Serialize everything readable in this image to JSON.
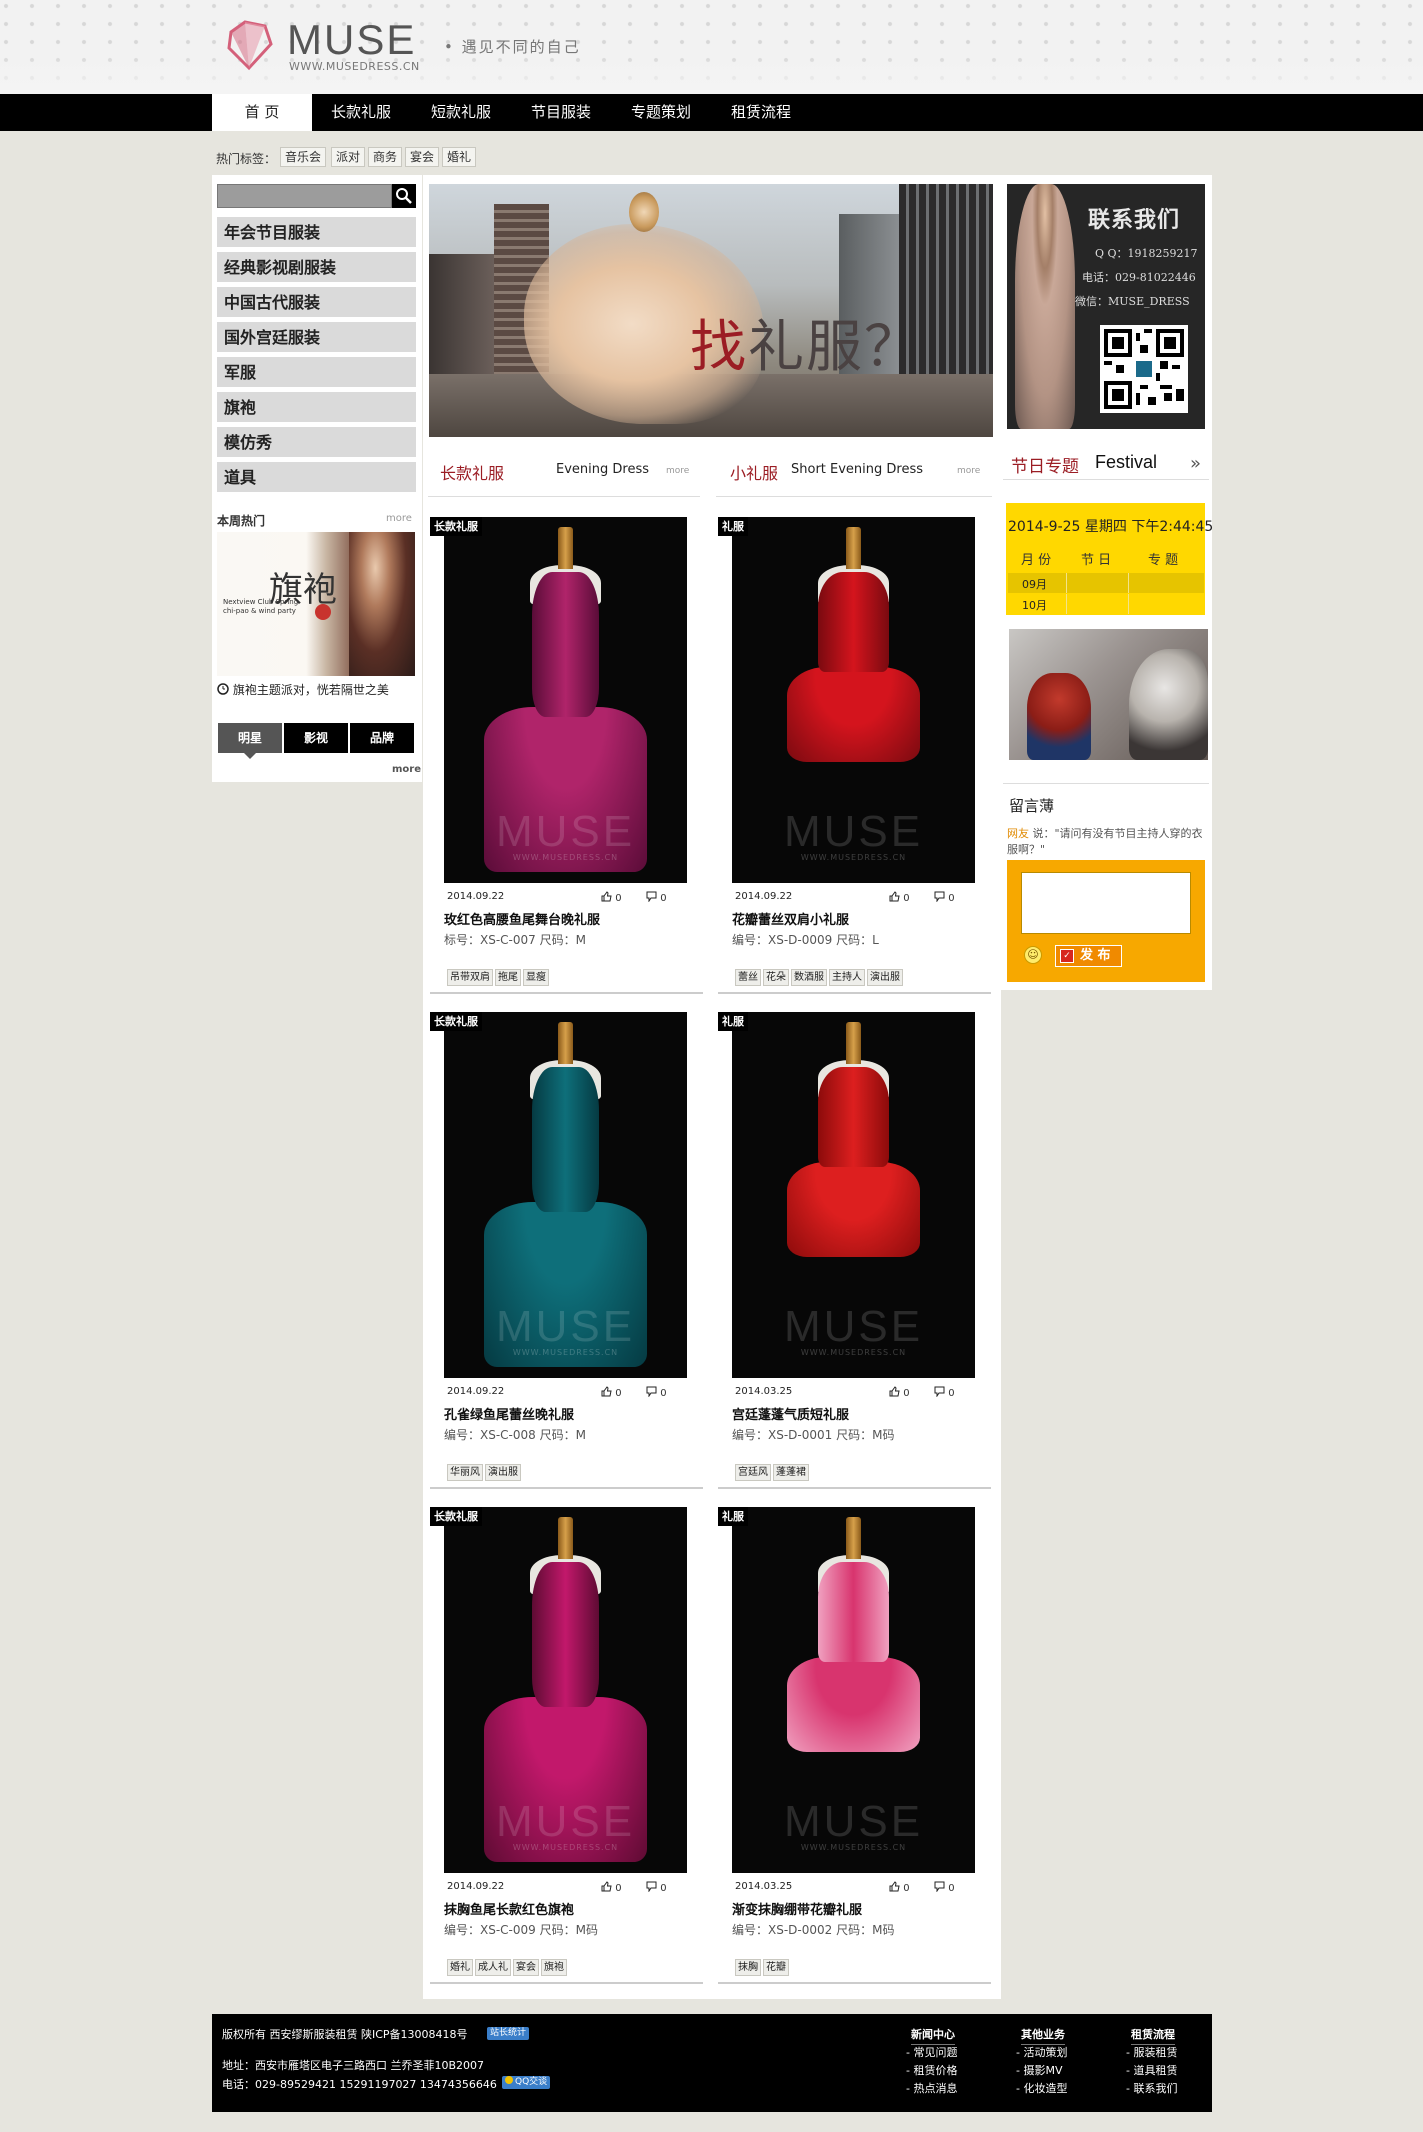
{
  "header": {
    "logo_text": "MUSE",
    "logo_url": "WWW.MUSEDRESS.CN",
    "slogan": "• 遇见不同的自己"
  },
  "nav": {
    "items": [
      {
        "label": "首 页",
        "active": true
      },
      {
        "label": "长款礼服"
      },
      {
        "label": "短款礼服"
      },
      {
        "label": "节目服装"
      },
      {
        "label": "专题策划"
      },
      {
        "label": "租赁流程"
      }
    ]
  },
  "hot_tags": {
    "label": "热门标签：",
    "tags": [
      "音乐会",
      "派对",
      "商务",
      "宴会",
      "婚礼"
    ]
  },
  "sidebar": {
    "search_placeholder": "",
    "categories": [
      "年会节目服装",
      "经典影视剧服装",
      "中国古代服装",
      "国外宫廷服装",
      "军服",
      "旗袍",
      "模仿秀",
      "道具"
    ],
    "week_hot": {
      "label": "本周热门",
      "more": "more",
      "image_big_text": "旗袍",
      "image_small_text": "Nextview Club Spring chi-pao & wind party",
      "caption": "旗袍主题派对，恍若隔世之美"
    },
    "tabs": [
      "明星",
      "影视",
      "品牌"
    ],
    "tabs_more": "more"
  },
  "banner": {
    "text_red": "找",
    "text_rest": "礼服？"
  },
  "sections": {
    "long": {
      "cn": "长款礼服",
      "en": "Evening Dress",
      "more": "more"
    },
    "short": {
      "cn": "小礼服",
      "en": "Short Evening Dress",
      "more": "more"
    }
  },
  "watermark": {
    "brand": "MUSE",
    "url": "WWW.MUSEDRESS.CN"
  },
  "products": [
    {
      "badge": "长款礼服",
      "date": "2014.09.22",
      "likes": "0",
      "comments": "0",
      "title": "玫红色高腰鱼尾舞台晚礼服",
      "code": "标号：XS-C-007 尺码：M",
      "tags": [
        "吊带双肩",
        "拖尾",
        "显瘦"
      ],
      "colors": {
        "main": "#b0246a",
        "dark": "#5a0c38"
      }
    },
    {
      "badge": "礼服",
      "date": "2014.09.22",
      "likes": "0",
      "comments": "0",
      "title": "花瓣蕾丝双肩小礼服",
      "code": "编号：XS-D-0009 尺码：L",
      "tags": [
        "蕾丝",
        "花朵",
        "数酒服",
        "主持人",
        "演出服"
      ],
      "colors": {
        "main": "#d4141d",
        "dark": "#7a0a10"
      }
    },
    {
      "badge": "长款礼服",
      "date": "2014.09.22",
      "likes": "0",
      "comments": "0",
      "title": "孔雀绿鱼尾蕾丝晚礼服",
      "code": "编号：XS-C-008 尺码：M",
      "tags": [
        "华丽风",
        "演出服"
      ],
      "colors": {
        "main": "#0e6f7a",
        "dark": "#053a42"
      }
    },
    {
      "badge": "礼服",
      "date": "2014.03.25",
      "likes": "0",
      "comments": "0",
      "title": "宫廷蓬蓬气质短礼服",
      "code": "编号：XS-D-0001 尺码：M码",
      "tags": [
        "宫廷风",
        "蓬蓬裙"
      ],
      "colors": {
        "main": "#dd1f1f",
        "dark": "#8c0b0b"
      }
    },
    {
      "badge": "长款礼服",
      "date": "2014.09.22",
      "likes": "0",
      "comments": "0",
      "title": "抹胸鱼尾长款红色旗袍",
      "code": "编号：XS-C-009 尺码：M码",
      "tags": [
        "婚礼",
        "成人礼",
        "宴会",
        "旗袍"
      ],
      "colors": {
        "main": "#c2186b",
        "dark": "#5e0b33"
      }
    },
    {
      "badge": "礼服",
      "date": "2014.03.25",
      "likes": "0",
      "comments": "0",
      "title": "渐变抹胸绷带花瓣礼服",
      "code": "编号：XS-D-0002 尺码：M码",
      "tags": [
        "抹胸",
        "花瓣"
      ],
      "colors": {
        "main": "#d8346e",
        "dark": "#f0a1c0"
      }
    }
  ],
  "contact": {
    "title": "联系我们",
    "qq": "Q Q：1918259217",
    "phone": "电话：029-81022446",
    "wechat": "微信：MUSE_DRESS"
  },
  "festival": {
    "cn": "节日专题",
    "en": "Festival",
    "arrow": "»",
    "datetime": "2014-9-25 星期四 下午2:44:45",
    "headers": [
      "月 份",
      "节 日",
      "专 题"
    ],
    "months": [
      "09月",
      "10月"
    ]
  },
  "guestbook": {
    "title": "留言薄",
    "user": "网友",
    "message": " 说：\"请问有没有节目主持人穿的衣服啊？\"",
    "publish": "发 布"
  },
  "footer": {
    "copyright": "版权所有 西安缪斯服装租赁 陕ICP备13008418号",
    "address": "地址：西安市雁塔区电子三路西口 兰乔圣菲10B2007",
    "phone": "电话：029-89529421 15291197027 13474356646",
    "badge1": "站长统计",
    "badge2": "QQ交谈",
    "columns": [
      {
        "title": "新闻中心",
        "items": [
          "常见问题",
          "租赁价格",
          "热点消息"
        ]
      },
      {
        "title": "其他业务",
        "items": [
          "活动策划",
          "摄影MV",
          "化妆造型"
        ]
      },
      {
        "title": "租赁流程",
        "items": [
          "服装租赁",
          "道具租赁",
          "联系我们"
        ]
      }
    ]
  }
}
